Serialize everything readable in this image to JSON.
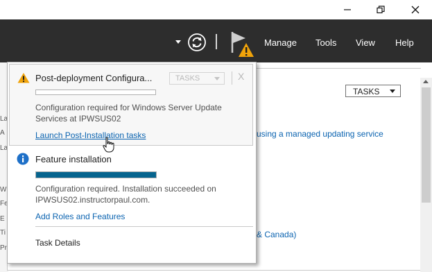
{
  "window": {
    "minimize_icon": "minimize-icon",
    "maximize_icon": "restore-icon",
    "close_icon": "close-icon"
  },
  "header": {
    "refresh_icon": "refresh-icon",
    "notifications_icon": "flag-warning-icon",
    "menu": [
      "Manage",
      "Tools",
      "View",
      "Help"
    ]
  },
  "background": {
    "tasks_label": "TASKS",
    "left_letters": [
      "La",
      "A",
      "La",
      "W",
      "Fe",
      "E",
      "Ti",
      "Pr"
    ],
    "link_1": "using a managed updating service",
    "link_2": "& Canada)"
  },
  "notifications": [
    {
      "icon": "warning-icon",
      "title": "Post-deployment Configura...",
      "tasks_label": "TASKS",
      "close_label": "X",
      "progress": 0,
      "body": "Configuration required for Windows Server Update Services at IPWSUS02",
      "link": "Launch Post-Installation tasks"
    },
    {
      "icon": "info-icon",
      "title": "Feature installation",
      "progress": 1.0,
      "body": "Configuration required. Installation succeeded on IPWSUS02.instructorpaul.com.",
      "link": "Add Roles and Features"
    }
  ],
  "footer": {
    "task_details_label": "Task Details"
  },
  "colors": {
    "header_bg": "#2d2d2d",
    "link": "#0a63b0",
    "progress_fill": "#06648e",
    "warning": "#f0a30a",
    "info": "#1e70c8"
  }
}
